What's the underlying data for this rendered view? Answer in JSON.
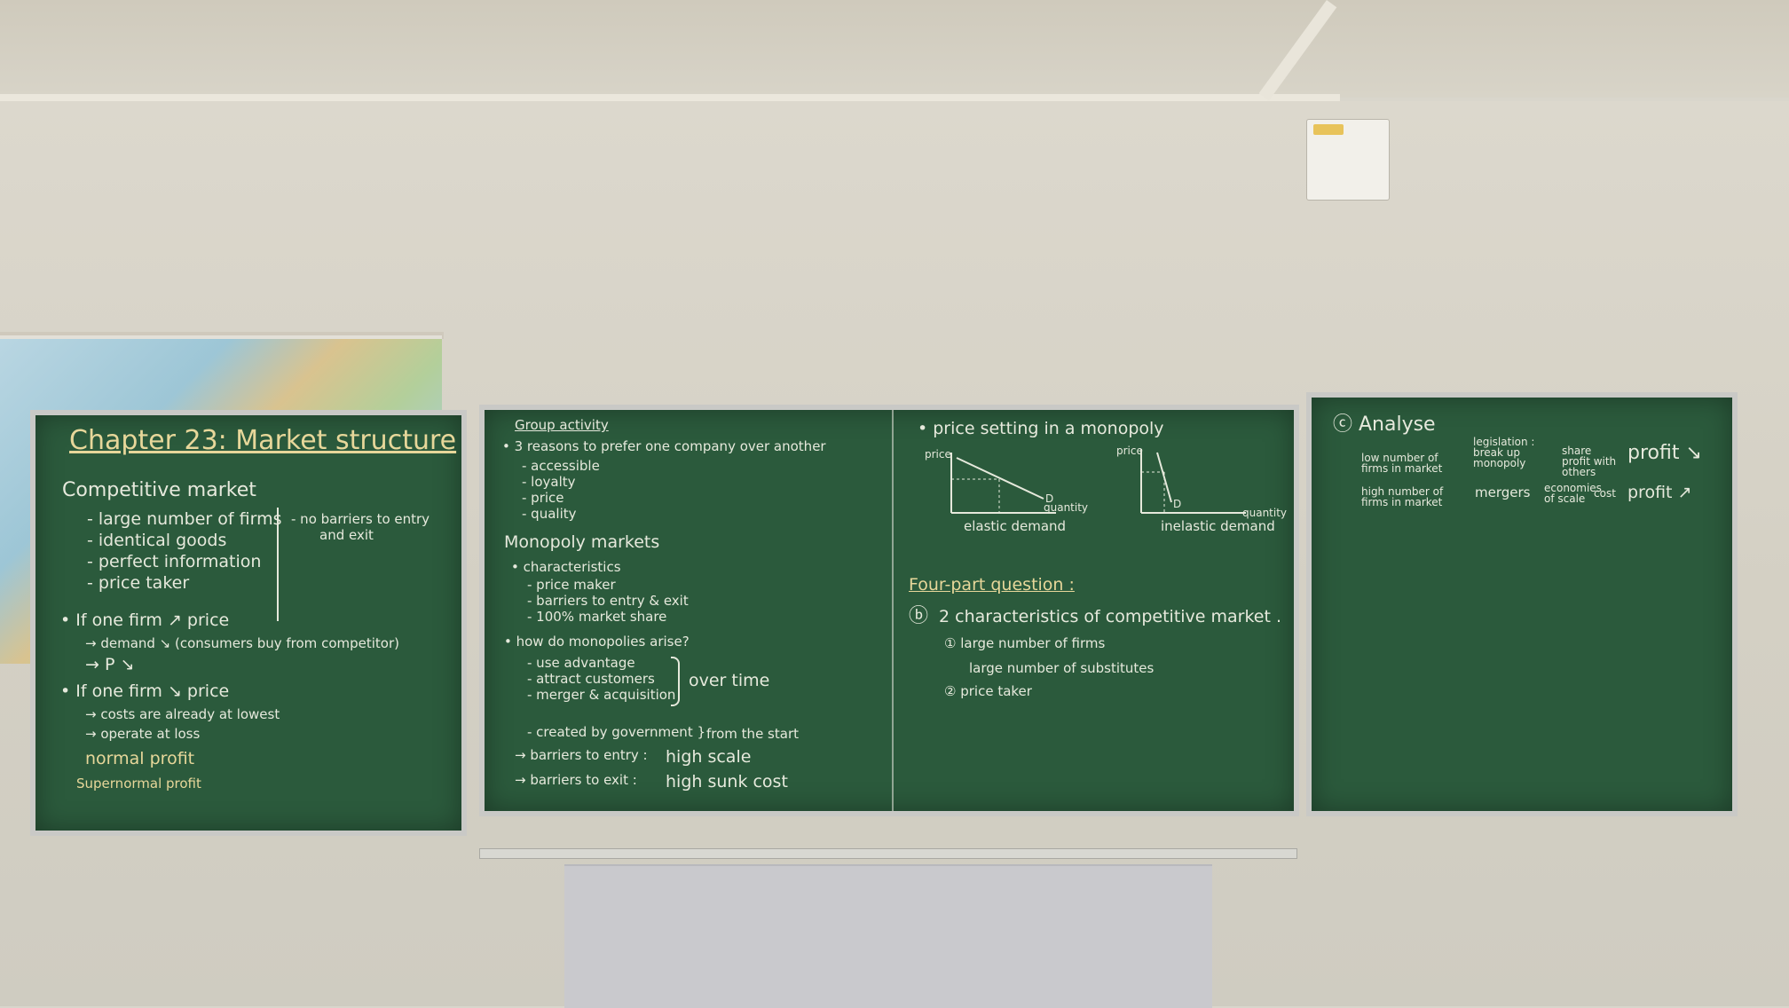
{
  "left_board": {
    "title": "Chapter 23: Market structure",
    "section_competitive": "Competitive market",
    "competitive_items": [
      "- large number of firms",
      "- identical goods",
      "- perfect information",
      "- price taker"
    ],
    "barriers_note_line1": "- no barriers to entry",
    "barriers_note_line2": "and exit",
    "price_up": "• If one firm ↗ price",
    "demand_down": "→ demand ↘ (consumers buy from competitor)",
    "p_down": "→ P ↘",
    "price_down": "• If one firm ↘ price",
    "costs_lowest": "→ costs are already at lowest",
    "operate_loss": "→ operate at loss",
    "normal_profit": "normal profit",
    "supernormal_profit": "Supernormal profit"
  },
  "center_board": {
    "group_activity": "Group activity",
    "reasons_heading": "• 3 reasons to prefer one company over another",
    "reasons": [
      "- accessible",
      "- loyalty",
      "- price",
      "- quality"
    ],
    "monopoly_heading": "Monopoly markets",
    "characteristics": "• characteristics",
    "characteristic_items": [
      "- price maker",
      "- barriers to entry & exit",
      "- 100% market share"
    ],
    "how_arise": "• how do monopolies arise?",
    "arise_items": [
      "- use advantage",
      "- attract customers",
      "- merger & acquisition"
    ],
    "over_time": "over time",
    "govt": "- created by government }",
    "from_start": "from the start",
    "entry": "→ barriers to entry :",
    "high_scale": "high scale",
    "exit": "→ barriers to exit :",
    "high_sunk_cost": "high sunk cost",
    "price_setting": "• price setting in a monopoly",
    "graph_price_label": "price",
    "graph_quantity_label": "quantity",
    "graph_d_label": "D",
    "elastic": "elastic demand",
    "inelastic": "inelastic demand",
    "four_part": "Four-part question :",
    "b_label": "ⓑ",
    "two_chars": "2 characteristics of competitive market .",
    "one": "① large number of firms",
    "one_sub": "large number of substitutes",
    "two": "② price taker"
  },
  "right_board": {
    "analyse": "ⓒ Analyse",
    "row1_left": "low number of firms in market",
    "row1_mid1": "legislation : break up monopoly",
    "row1_mid2": "share profit with others",
    "row1_end": "profit ↘",
    "row2_left": "high number of firms in market",
    "row2_mid1": "mergers",
    "row2_mid2": "economies of scale",
    "row2_mid3": "cost",
    "row2_end": "profit ↗"
  },
  "colors": {
    "board": "#2b5a3c",
    "chalk": "#e6e9dc",
    "chalk_yellow": "#e7d79a",
    "frame": "#c9c9c6",
    "wall": "#d6d2c6"
  }
}
